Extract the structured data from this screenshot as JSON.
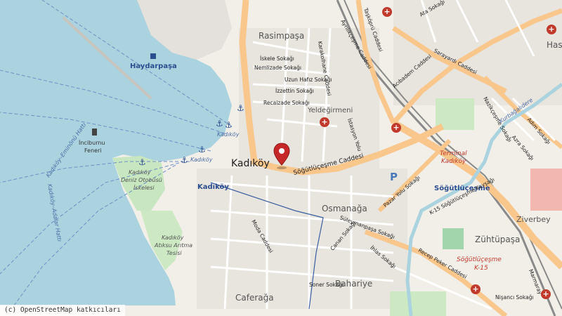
{
  "map": {
    "districts": {
      "rasimpasa": "Rasimpaşa",
      "kadikoy": "Kadıköy",
      "osmanaga": "Osmanağa",
      "yeldegirmeni": "Yeldeğirmeni",
      "caferaga": "Caferağa",
      "bahariye": "Bahariye",
      "zuhtupasa": "Zühtüpaşa",
      "ziverbey": "Ziverbey",
      "has": "Has"
    },
    "stations": {
      "haydarpasa": "Haydarpaşa",
      "kadikoy": "Kadıköy",
      "sogutlucesme": "Söğütlüçeşme"
    },
    "piers": {
      "kadikoy_pier": "Kadıköy",
      "kadikoy_pier_2": "Kadıköy"
    },
    "landmarks": {
      "inciburnu": "İnciburnu",
      "feneri": "Feneri",
      "deniz_otobusu_1": "Kadıköy",
      "deniz_otobusu_2": "Deniz Otobüsü",
      "deniz_otobusu_3": "İskelesi",
      "aritma_1": "Kadıköy",
      "aritma_2": "Atıksu Arıtma",
      "aritma_3": "Tesisi",
      "terminal_1": "Terminal",
      "terminal_2": "Kadıköy",
      "k15_1": "Söğütlüçeşme",
      "k15_2": "K-15",
      "k15_kavsagi": "K-15 Söğütlüçeşme Kavşağı"
    },
    "streets": {
      "sogutlucesme": "Söğütlüçeşme Caddesi",
      "taskopru": "Taşköprü Caddesi",
      "acibadem": "Acıbadem Caddesi",
      "sarayardi": "Sarayardı Caddesi",
      "recep_peker": "Recep Peker Caddesi",
      "pazar_yolu": "Pazar Yolu Sokağı",
      "iskele": "İskele Sokağı",
      "nemlizade": "Nemlizade Sokağı",
      "uzun_hafiz": "Uzun Hafız Sokağı",
      "izzettin": "İzzettin Sokağı",
      "recaizade": "Recaizade Sokağı",
      "karakolhane": "Karakolhane Caddesi",
      "ayrilikcesme": "Ayrılıkçeşme Caddesi",
      "istasyon": "İstasyon Yolu",
      "suleymanpasa": "Süleymanpaşa Sokağı",
      "canan": "Canan Sokağı",
      "ihlas": "İhlas Sokağı",
      "soner": "Soner Sokağı",
      "moda": "Moda Caddesi",
      "nisanci": "Nişancı Sokağı",
      "adim": "Adım Sokağı",
      "azra": "Azra Sokağı",
      "ata": "Ata Sokağı",
      "nazikcesme": "Nazikçeşme Sokağı",
      "kurbagalidere": "Kurbağalıdere",
      "marmaray": "Marmaray",
      "kadikoy_adalar": "Kadıköy–Adalar Hattı",
      "kadikoy_eminonu": "Kadıköy–Eminönü Hattı"
    },
    "parking": "P",
    "pin_location": "Kadıköy, Söğütlüçeşme Caddesi"
  },
  "attribution": "(c) OpenStreetMap katkıcıları"
}
